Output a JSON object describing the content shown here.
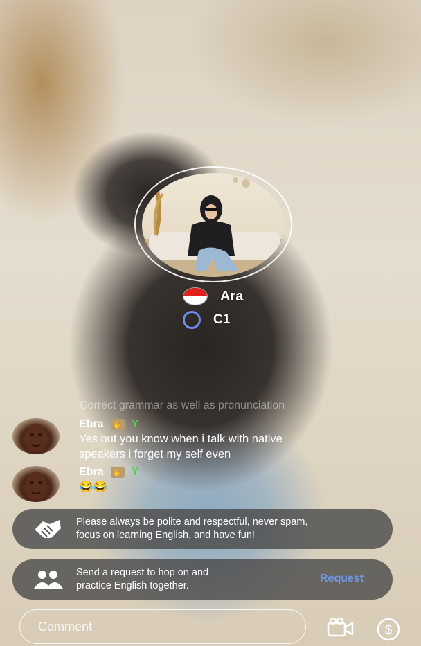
{
  "host": {
    "name": "Ara",
    "level": "C1",
    "flag_colors": {
      "top": "#e1201e",
      "bottom": "#ffffff"
    },
    "level_color": "#6c8df0"
  },
  "chat": {
    "faded_message": "Correct grammar as well as pronunciation",
    "messages": [
      {
        "user": "Ebra",
        "badges": [
          "hand-badge-icon",
          "sprout-icon"
        ],
        "text_line1": "Yes but you know when i talk with native",
        "text_line2": "speakers i forget my self even"
      },
      {
        "user": "Ebra",
        "badges": [
          "hand-badge-icon",
          "sprout-icon"
        ],
        "text_line1": "😂😂",
        "text_line2": ""
      }
    ]
  },
  "rules_banner": {
    "icon": "handshake-icon",
    "line1": "Please always be polite and respectful, never spam,",
    "line2": "focus on learning English, and have fun!"
  },
  "request_banner": {
    "icon": "people-icon",
    "line1": "Send a request to hop on and",
    "line2": "practice English together.",
    "button_label": "Request",
    "button_color": "#6f97ea"
  },
  "comment": {
    "placeholder": "Comment"
  },
  "bottom_icons": [
    "video-camera-icon",
    "dollar-coin-icon"
  ]
}
